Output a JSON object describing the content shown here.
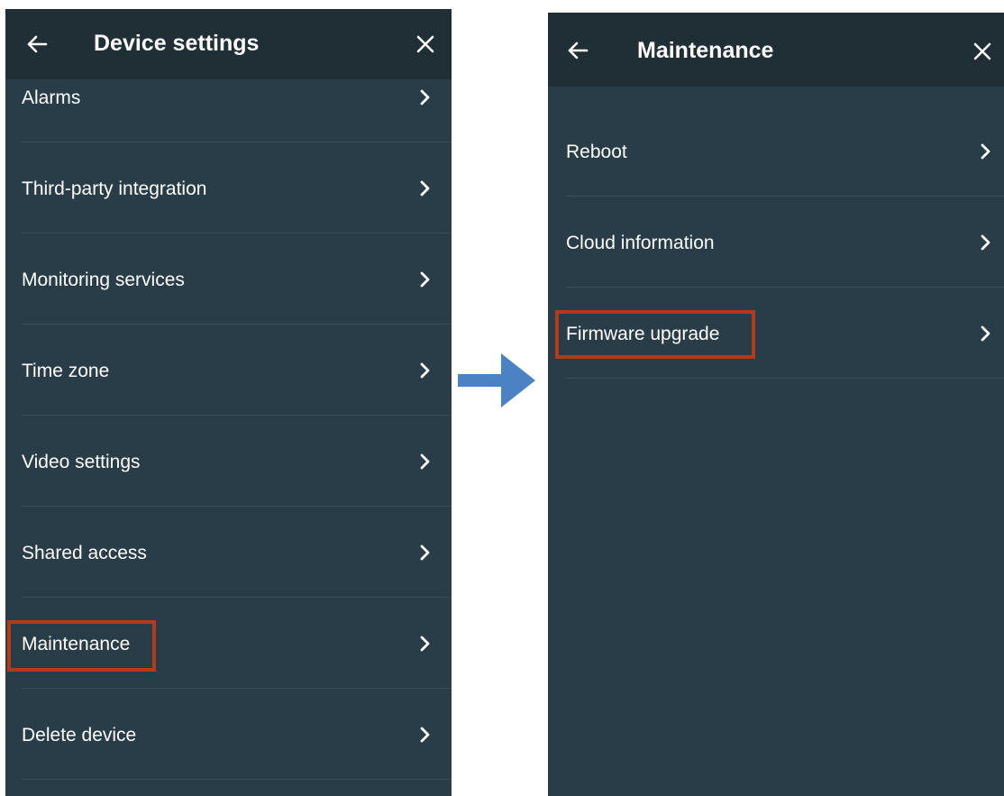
{
  "left_panel": {
    "title": "Device settings",
    "back_icon": "arrow-left-icon",
    "close_icon": "close-icon",
    "items": [
      {
        "label": "Alarms"
      },
      {
        "label": "Third-party integration"
      },
      {
        "label": "Monitoring services"
      },
      {
        "label": "Time zone"
      },
      {
        "label": "Video settings"
      },
      {
        "label": "Shared access"
      },
      {
        "label": "Maintenance",
        "highlighted": true
      },
      {
        "label": "Delete device"
      }
    ]
  },
  "right_panel": {
    "title": "Maintenance",
    "back_icon": "arrow-left-icon",
    "close_icon": "close-icon",
    "items": [
      {
        "label": "Reboot"
      },
      {
        "label": "Cloud information"
      },
      {
        "label": "Firmware upgrade",
        "highlighted": true
      }
    ]
  },
  "colors": {
    "panel_bg": "#283d47",
    "header_bg": "#202e36",
    "divider": "#3a4f59",
    "highlight": "#b33a1b",
    "arrow": "#4a82c3"
  },
  "flow_arrow_icon": "arrow-right-icon"
}
